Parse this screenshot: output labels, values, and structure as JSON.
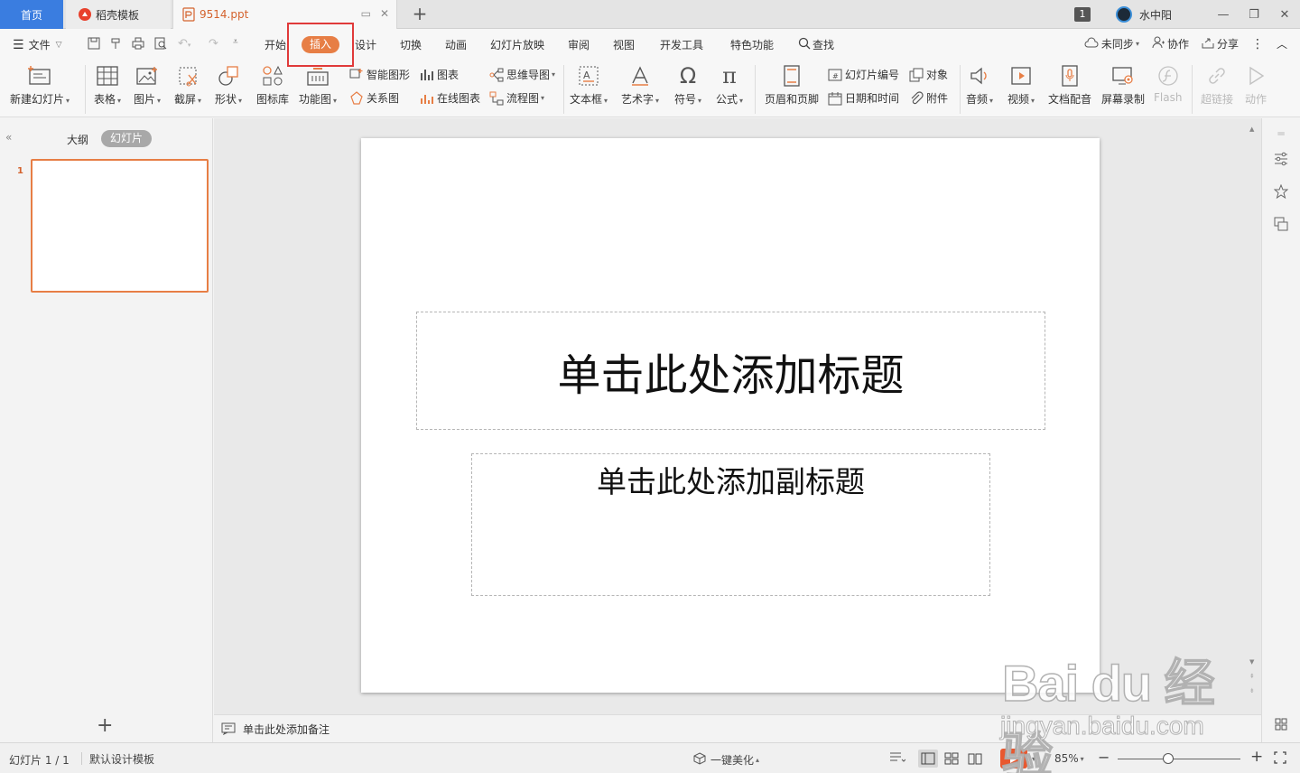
{
  "titlebar": {
    "tabs": {
      "home": "首页",
      "template": "稻壳模板",
      "document": "9514.ppt"
    },
    "window_count": "1",
    "user_name": "水中阳"
  },
  "menu": {
    "file": "文件",
    "items": {
      "home": "开始",
      "insert": "插入",
      "design": "设计",
      "transition": "切换",
      "animation": "动画",
      "slideshow": "幻灯片放映",
      "review": "审阅",
      "view": "视图",
      "developer": "开发工具",
      "special": "特色功能",
      "find": "查找"
    },
    "right": {
      "sync": "未同步",
      "collab": "协作",
      "share": "分享"
    }
  },
  "toolbar": {
    "new_slide": "新建幻灯片",
    "table": "表格",
    "picture": "图片",
    "screenshot": "截屏",
    "shape": "形状",
    "icon_lib": "图标库",
    "func_chart": "功能图",
    "smart_art": "智能图形",
    "relation": "关系图",
    "chart": "图表",
    "online_chart": "在线图表",
    "mindmap": "思维导图",
    "flowchart": "流程图",
    "textbox": "文本框",
    "wordart": "艺术字",
    "symbol": "符号",
    "formula": "公式",
    "header_footer": "页眉和页脚",
    "slide_number": "幻灯片编号",
    "datetime": "日期和时间",
    "object": "对象",
    "attachment": "附件",
    "audio": "音频",
    "video": "视频",
    "doc_dub": "文档配音",
    "screen_record": "屏幕录制",
    "flash": "Flash",
    "hyperlink": "超链接",
    "action": "动作"
  },
  "leftpanel": {
    "outline": "大纲",
    "slides": "幻灯片",
    "slide_number": "1"
  },
  "slide": {
    "title_placeholder": "单击此处添加标题",
    "subtitle_placeholder": "单击此处添加副标题"
  },
  "notes": {
    "placeholder": "单击此处添加备注"
  },
  "statusbar": {
    "slide_info": "幻灯片 1 / 1",
    "theme": "默认设计模板",
    "beautify": "一键美化",
    "zoom": "85%"
  },
  "watermark": {
    "logo": "Bai du 经验",
    "url": "jingyan.baidu.com"
  },
  "colors": {
    "accent": "#e77e45",
    "home_tab": "#3a7de0",
    "highlight_box": "#e03a3a",
    "play": "#e8582f"
  }
}
